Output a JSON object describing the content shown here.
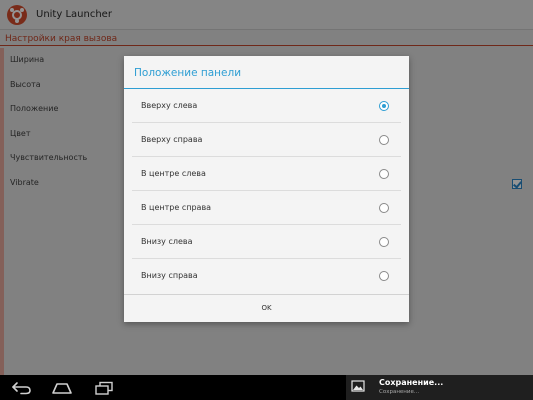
{
  "app": {
    "title": "Unity Launcher",
    "section_header": "Настройки края вызова",
    "settings": [
      {
        "label": "Ширина"
      },
      {
        "label": "Высота"
      },
      {
        "label": "Положение"
      },
      {
        "label": "Цвет"
      },
      {
        "label": "Чувствительность"
      },
      {
        "label": "Vibrate",
        "checked": true
      }
    ]
  },
  "dialog": {
    "title": "Положение панели",
    "options": [
      {
        "label": "Вверху слева",
        "selected": true
      },
      {
        "label": "Вверху справа",
        "selected": false
      },
      {
        "label": "В центре слева",
        "selected": false
      },
      {
        "label": "В центре справа",
        "selected": false
      },
      {
        "label": "Внизу слева",
        "selected": false
      },
      {
        "label": "Внизу справа",
        "selected": false
      }
    ],
    "ok_label": "OK"
  },
  "notification": {
    "title": "Сохранение...",
    "subtitle": "Сохранение..."
  },
  "icons": {
    "app": "ubuntu-logo-icon",
    "back": "back-arrow-icon",
    "home": "home-icon",
    "recent": "recent-apps-icon",
    "notification": "image-icon"
  },
  "colors": {
    "accent": "#2e9ed3",
    "section_accent": "#c0452b"
  }
}
